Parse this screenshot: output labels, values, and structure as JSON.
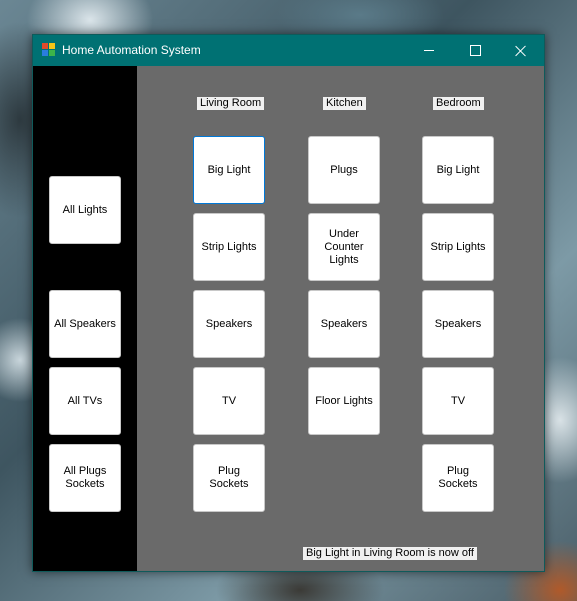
{
  "window": {
    "title": "Home Automation System"
  },
  "sidebar": {
    "all_lights": "All Lights",
    "all_speakers": "All Speakers",
    "all_tvs": "All TVs",
    "all_plugs": "All Plugs\nSockets"
  },
  "rooms": {
    "living_room": {
      "label": "Living Room",
      "big_light": "Big Light",
      "strip_lights": "Strip Lights",
      "speakers": "Speakers",
      "tv": "TV",
      "plug_sockets": "Plug\nSockets"
    },
    "kitchen": {
      "label": "Kitchen",
      "plugs": "Plugs",
      "under_counter": "Under\nCounter\nLights",
      "speakers": "Speakers",
      "floor_lights": "Floor Lights"
    },
    "bedroom": {
      "label": "Bedroom",
      "big_light": "Big Light",
      "strip_lights": "Strip Lights",
      "speakers": "Speakers",
      "tv": "TV",
      "plug_sockets": "Plug\nSockets"
    }
  },
  "status": {
    "message": "Big Light in Living Room is now off"
  },
  "colors": {
    "titlebar": "#007173",
    "sidebar": "#000000",
    "panel": "#6a6a6a",
    "focus_border": "#0078d7"
  }
}
